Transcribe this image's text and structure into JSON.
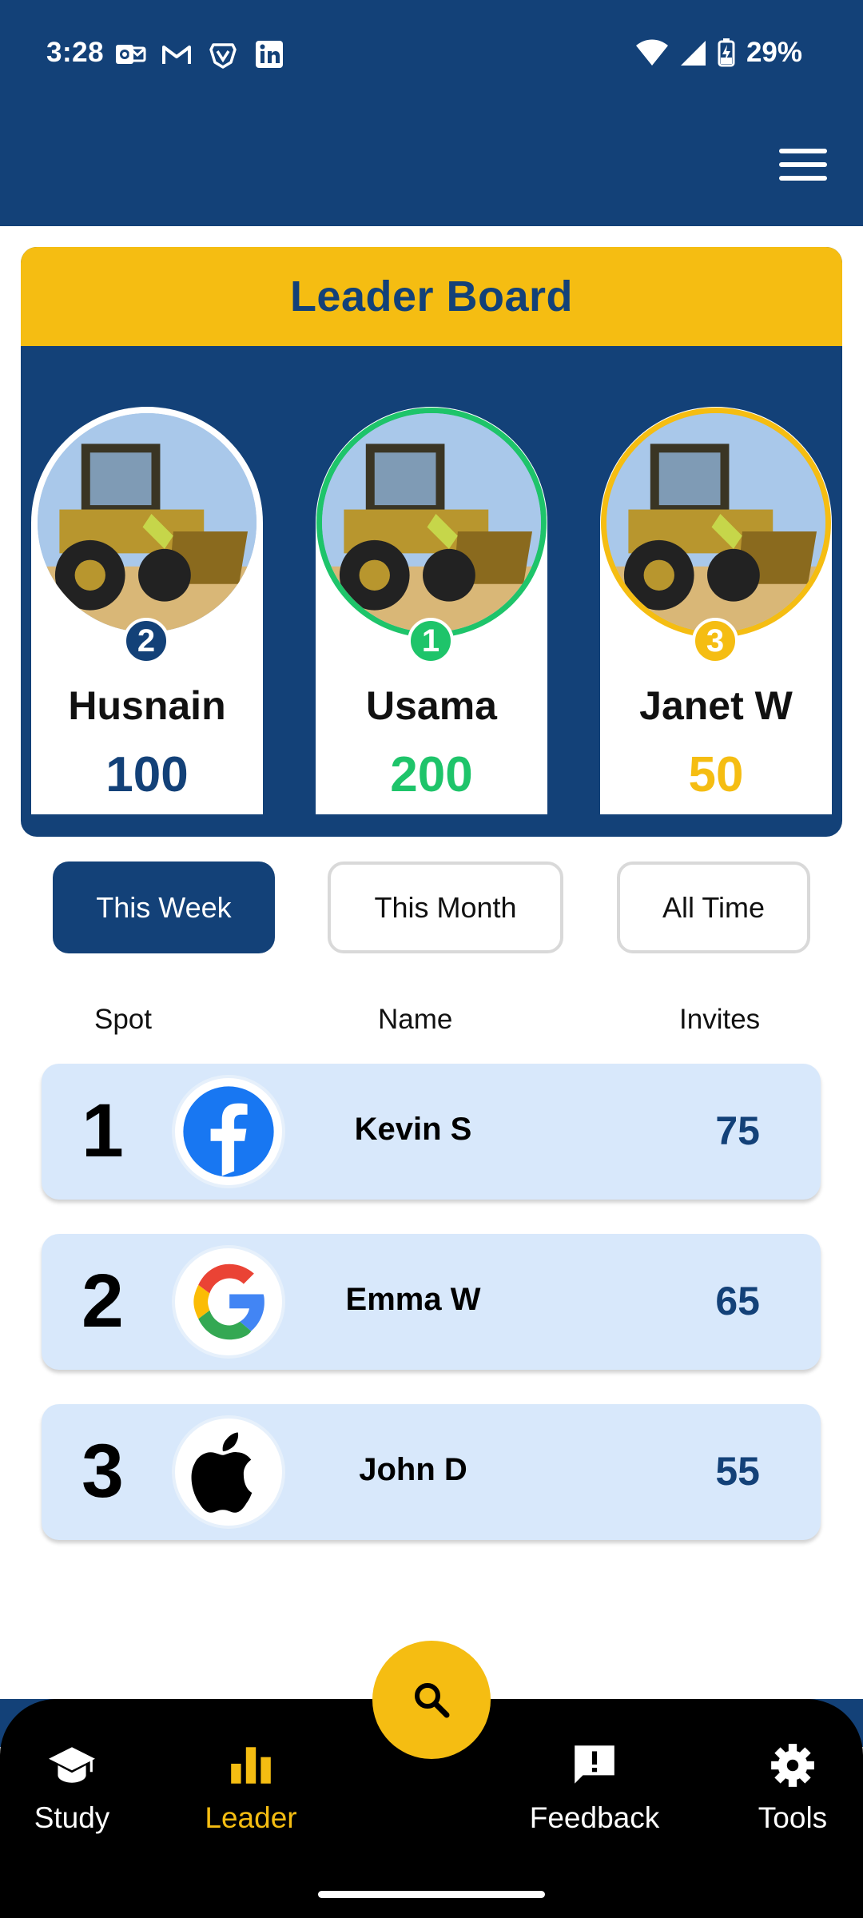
{
  "status_bar": {
    "time": "3:28",
    "battery_percent": "29%",
    "notification_icons": [
      "outlook-icon",
      "gmail-icon",
      "brave-icon",
      "linkedin-icon"
    ]
  },
  "app_bar": {
    "menu_icon": "hamburger-menu-icon"
  },
  "leaderboard": {
    "title": "Leader Board",
    "top3": [
      {
        "rank": "2",
        "name": "Husnain",
        "score": "100",
        "color": "#134178"
      },
      {
        "rank": "1",
        "name": "Usama",
        "score": "200",
        "color": "#1ec46a"
      },
      {
        "rank": "3",
        "name": "Janet W",
        "score": "50",
        "color": "#f5bd12"
      }
    ]
  },
  "filters": {
    "week": "This Week",
    "month": "This Month",
    "all_time": "All Time",
    "selected": "This Week"
  },
  "table": {
    "headers": {
      "spot": "Spot",
      "name": "Name",
      "invites": "Invites"
    },
    "rows": [
      {
        "spot": "1",
        "name": "Kevin S",
        "invites": "75",
        "logo": "facebook-icon"
      },
      {
        "spot": "2",
        "name": "Emma W",
        "invites": "65",
        "logo": "google-icon"
      },
      {
        "spot": "3",
        "name": "John D",
        "invites": "55",
        "logo": "apple-icon"
      }
    ]
  },
  "bottom_nav": {
    "items": [
      {
        "label": "Study",
        "icon": "graduation-cap-icon"
      },
      {
        "label": "Leader",
        "icon": "bar-chart-icon",
        "active": true
      },
      {
        "label": "Feedback",
        "icon": "feedback-icon"
      },
      {
        "label": "Tools",
        "icon": "gear-icon"
      }
    ],
    "fab_icon": "search-icon"
  },
  "colors": {
    "primary": "#134178",
    "accent": "#f5bd12",
    "first_place": "#1ec46a",
    "row_background": "#d8e8fb"
  }
}
